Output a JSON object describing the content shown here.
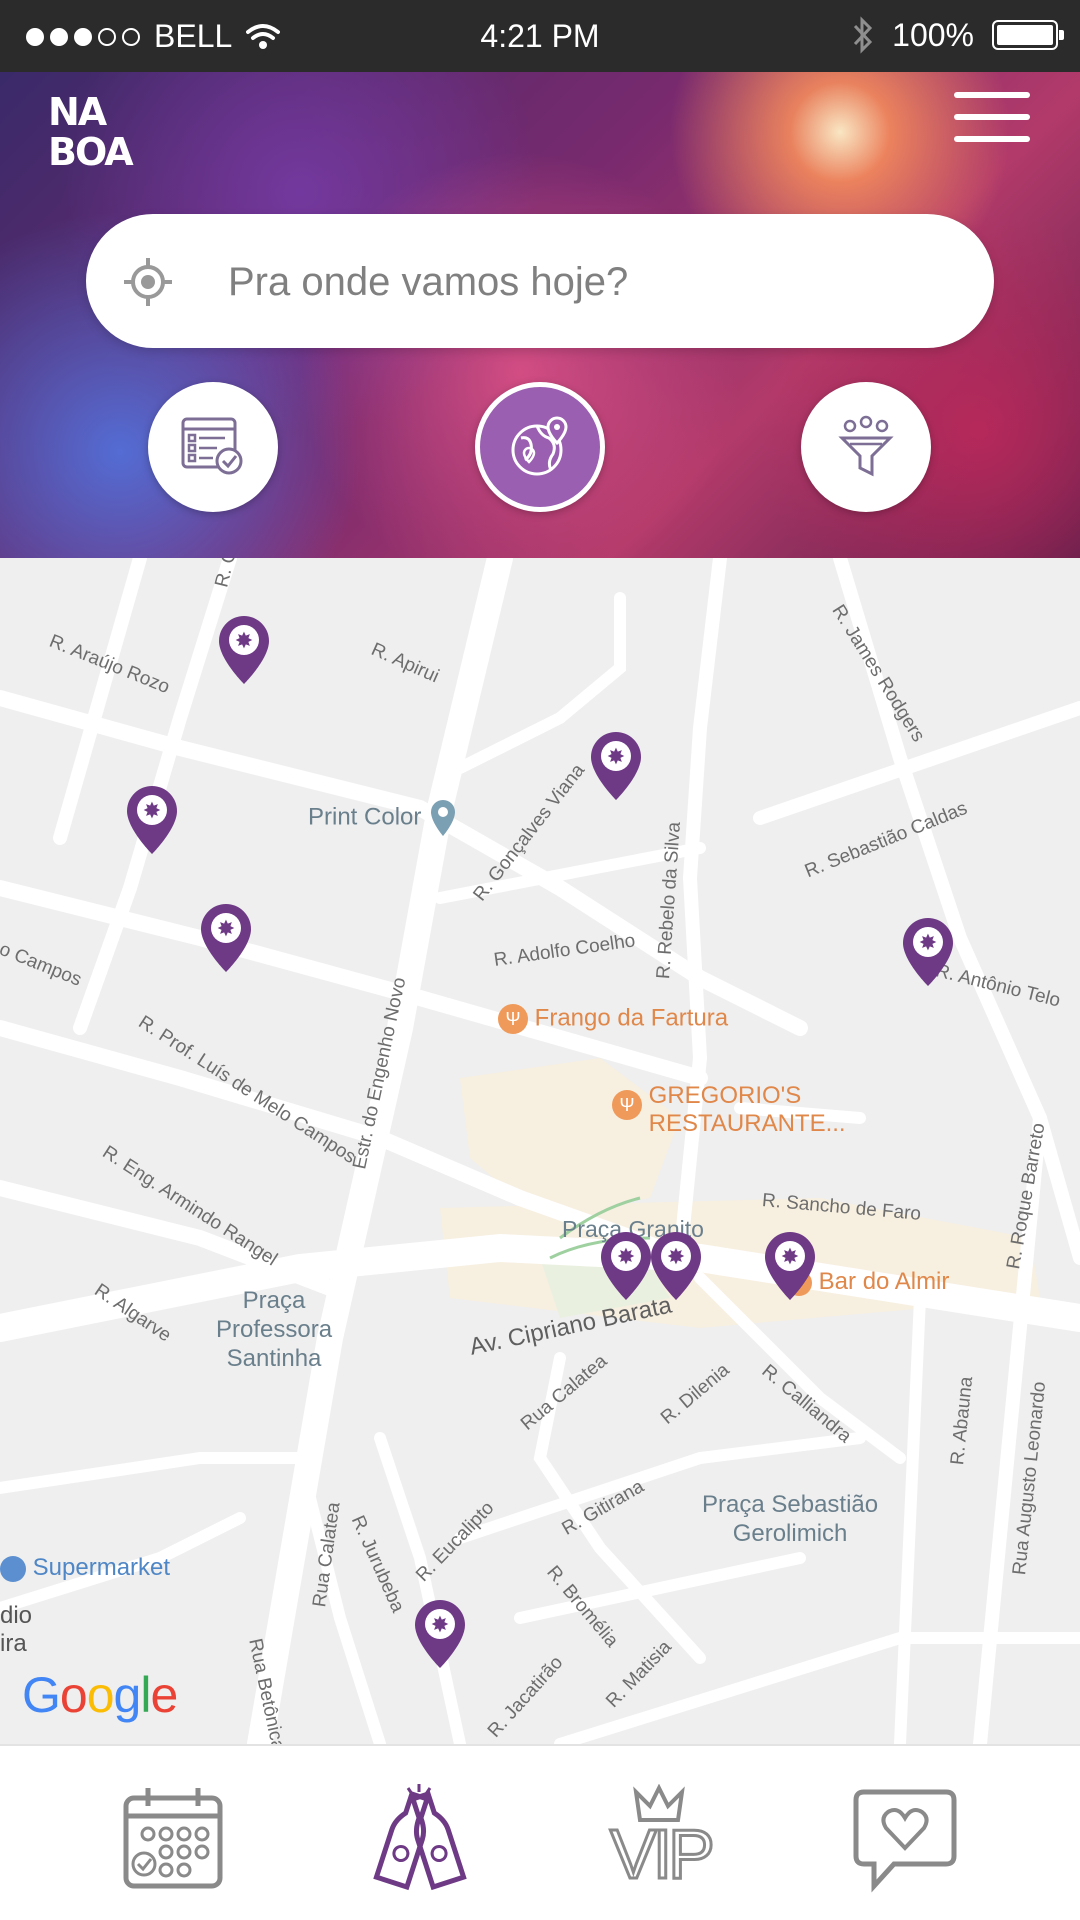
{
  "status_bar": {
    "carrier": "BELL",
    "time": "4:21 PM",
    "battery": "100%",
    "signal_dots_filled": 3,
    "signal_dots_total": 5,
    "battery_level": 1.0
  },
  "header": {
    "logo_line1": "NA",
    "logo_line2": "BOA",
    "search_placeholder": "Pra onde vamos hoje?",
    "accent_color": "#9a5fb0",
    "pin_color": "#6e3a86"
  },
  "map": {
    "street_labels": [
      "R. Araújo Rozo",
      "R. Apirui",
      "R. James Rodgers",
      "R. Gonçalves Viana",
      "R. Sebastião Caldas",
      "R. Adolfo Coelho",
      "R. Rebelo da Silva",
      "R. Antônio Telo",
      "o Campos",
      "R. Prof. Luís de Melo Campos",
      "Estr. do Engenho Novo",
      "R. Eng. Armindo Rangel",
      "R. Sancho de Faro",
      "R. Roque Barreto",
      "R. Algarve",
      "Av. Cipriano Barata",
      "Rua Calatea",
      "R. Dilenia",
      "R. Calliandra",
      "R. Abauna",
      "Rua Augusto Leonardo",
      "R. Gitirana",
      "R. Eucalipto",
      "R. Jurubeba",
      "Rua Calatea",
      "Rua Betônica",
      "R. Bromélia",
      "R. Jacatirão",
      "R. Matisia",
      "R. G"
    ],
    "place_labels": {
      "print_color": "Print Color",
      "frango": "Frango da Fartura",
      "gregorio_1": "GREGORIO'S",
      "gregorio_2": "RESTAURANTE...",
      "praca_granito": "Praça Granito",
      "bar_almir": "Bar do Almir",
      "praca_prof_1": "Praça",
      "praca_prof_2": "Professora",
      "praca_prof_3": "Santinha",
      "praca_seb_1": "Praça Sebastião",
      "praca_seb_2": "Gerolimich",
      "supermarket": "Supermarket",
      "edge_1": "dio",
      "edge_2": "ira"
    },
    "google": "Google",
    "pin_icon": "star-burst-icon"
  },
  "bottom_nav": [
    {
      "name": "calendar",
      "icon": "calendar-icon"
    },
    {
      "name": "bars",
      "icon": "beer-bottles-icon"
    },
    {
      "name": "vip",
      "icon": "vip-crown-icon",
      "label": "VIP"
    },
    {
      "name": "favorites",
      "icon": "heart-chat-icon"
    }
  ]
}
